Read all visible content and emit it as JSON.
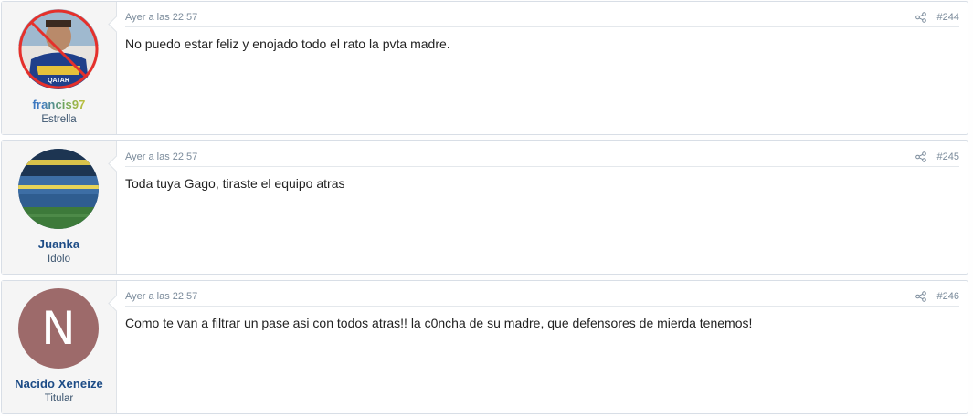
{
  "posts": [
    {
      "username": "francis97",
      "user_title": "Estrella",
      "date": "Ayer a las 22:57",
      "post_number": "#244",
      "message": "No puedo estar feliz y enojado todo el rato la pvta madre.",
      "avatar": "player-photo-crossed"
    },
    {
      "username": "Juanka",
      "user_title": "Idolo",
      "date": "Ayer a las 22:57",
      "post_number": "#245",
      "message": "Toda tuya Gago, tiraste el equipo atras",
      "avatar": "stadium-photo"
    },
    {
      "username": "Nacido Xeneize",
      "user_title": "Titular",
      "date": "Ayer a las 22:57",
      "post_number": "#246",
      "message": "Como te van a filtrar un pase asi con todos atras!! la c0ncha de su madre, que defensores de mierda tenemos!",
      "avatar_letter": "N",
      "avatar_color": "#9d6a6a"
    }
  ]
}
